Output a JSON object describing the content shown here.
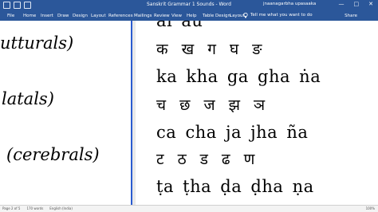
{
  "titlebar": {
    "title": "Sanskrit Grammar 1 Sounds - Word",
    "user": "jnaanagarbha upasaaka",
    "window_buttons": [
      "—",
      "□",
      "✕"
    ]
  },
  "ribbon": {
    "tabs": [
      "File",
      "Home",
      "Insert",
      "Draw",
      "Design",
      "Layout",
      "References",
      "Mailings",
      "Review",
      "View",
      "Help",
      "Table Design",
      "Layout"
    ],
    "tell_me": "Tell me what you want to do",
    "share": "Share"
  },
  "document": {
    "left_categories": [
      "utturals)",
      "latals)",
      "(cerebrals)"
    ],
    "lines": [
      "क ख ग घ ङ",
      "ka kha ga gha ṅa",
      "च छ ज झ ञ",
      "ca cha ja jha ña",
      "ट ठ ड ढ ण",
      "ṭa ṭha ḍa ḍha ṇa"
    ],
    "partial_top_line": "aĩ aũ"
  },
  "statusbar": {
    "page": "Page 2 of 5",
    "words": "170 words",
    "language": "English (India)",
    "zoom": "100%"
  },
  "colors": {
    "accent": "#2b579a",
    "page_border": "#2a5bd0"
  }
}
